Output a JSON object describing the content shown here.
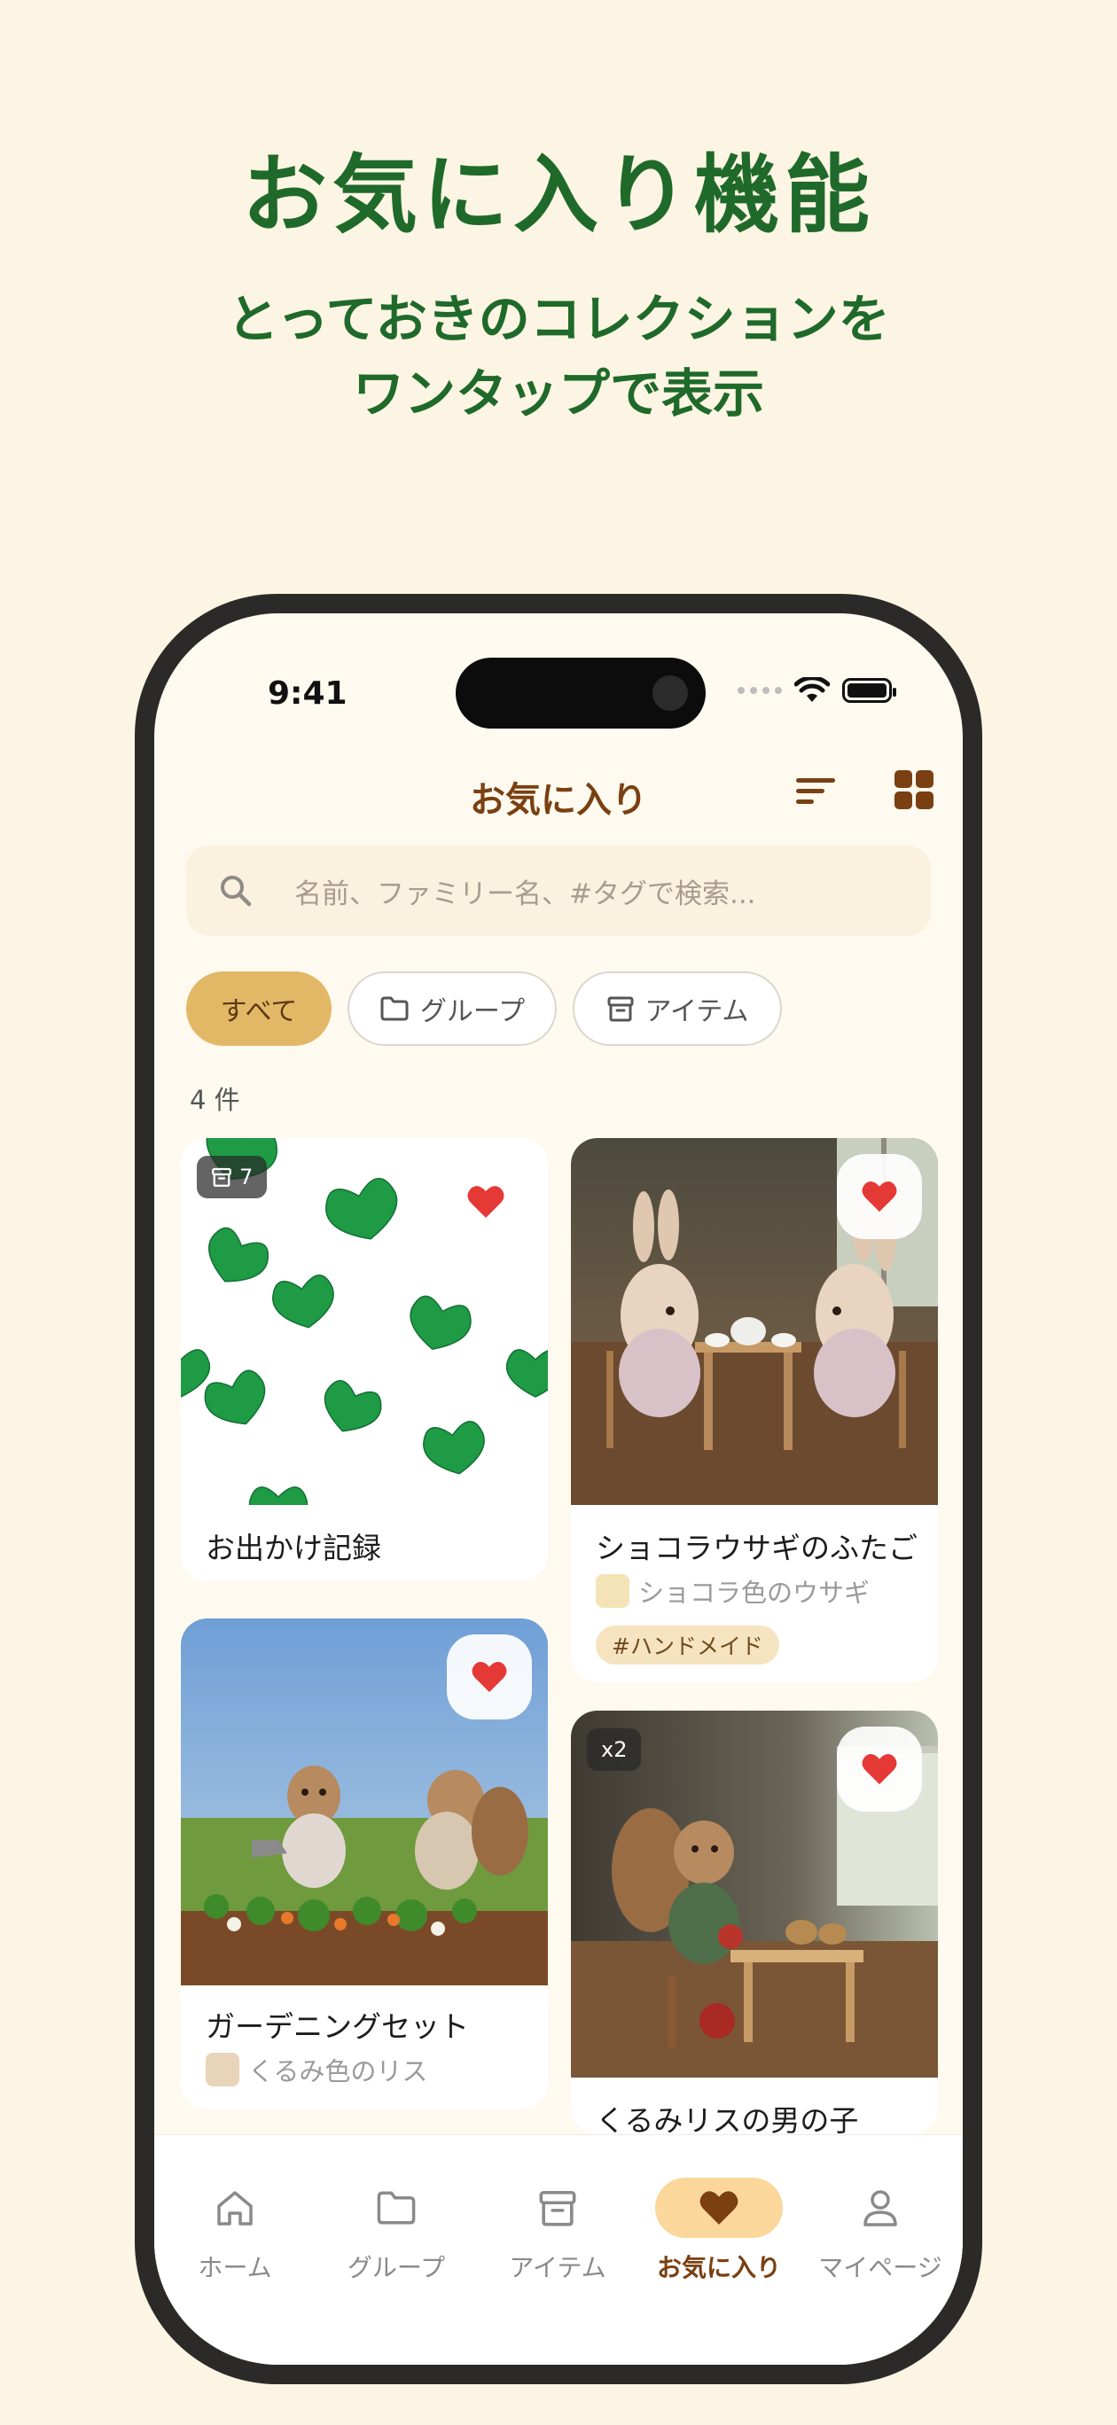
{
  "hero": {
    "title": "お気に入り機能",
    "subtitle_line1": "とっておきのコレクションを",
    "subtitle_line2": "ワンタップで表示"
  },
  "status_bar": {
    "time": "9:41"
  },
  "header": {
    "title": "お気に入り",
    "sort_icon": "sort-icon",
    "view_icon": "grid-view-icon"
  },
  "search": {
    "placeholder": "名前、ファミリー名、#タグで検索..."
  },
  "filters": [
    {
      "label": "すべて",
      "active": true
    },
    {
      "label": "グループ",
      "icon": "folder-icon"
    },
    {
      "label": "アイテム",
      "icon": "archive-box-icon"
    }
  ],
  "result_count": "4 件",
  "cards": [
    {
      "title": "お出かけ記録",
      "badge": "7",
      "badge_icon": "archive-box-icon",
      "favorite": true
    },
    {
      "title": "ショコラウサギのふたご",
      "family": "ショコラ色のウサギ",
      "tag": "#ハンドメイド",
      "favorite": true
    },
    {
      "title": "ガーデニングセット",
      "family": "くるみ色のリス",
      "favorite": true
    },
    {
      "title": "くるみリスの男の子",
      "badge": "x2",
      "favorite": true
    }
  ],
  "tabs": [
    {
      "label": "ホーム",
      "icon": "home-icon"
    },
    {
      "label": "グループ",
      "icon": "folder-icon"
    },
    {
      "label": "アイテム",
      "icon": "archive-box-icon"
    },
    {
      "label": "お気に入り",
      "icon": "heart-icon",
      "active": true
    },
    {
      "label": "マイページ",
      "icon": "person-icon"
    }
  ],
  "colors": {
    "background": "#fdf5e3",
    "hero_green": "#1f6a2a",
    "accent_brown": "#7a4012",
    "heart_red": "#e53935",
    "chip_active": "#e2b867"
  }
}
